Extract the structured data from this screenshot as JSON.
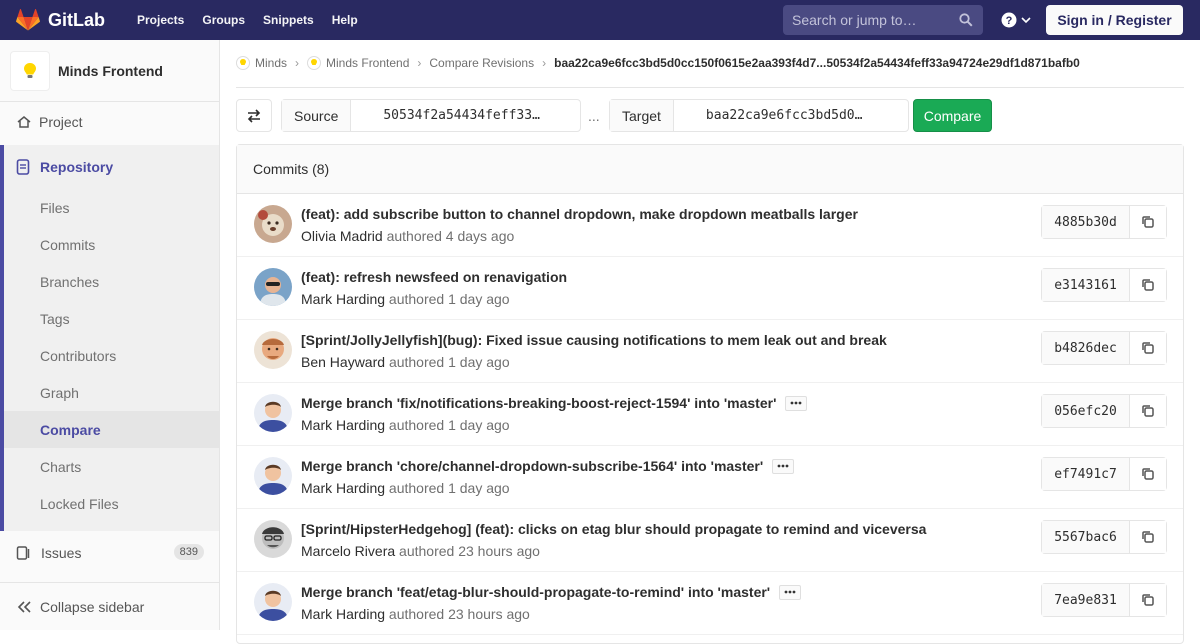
{
  "nav": {
    "brand": "GitLab",
    "links": [
      "Projects",
      "Groups",
      "Snippets",
      "Help"
    ],
    "search_placeholder": "Search or jump to…",
    "sign_in": "Sign in / Register",
    "colors": {
      "bar": "#292961",
      "accent": "#fc6d26"
    }
  },
  "sidebar": {
    "project_name": "Minds Frontend",
    "project_item": "Project",
    "repository": "Repository",
    "repo_items": [
      "Files",
      "Commits",
      "Branches",
      "Tags",
      "Contributors",
      "Graph",
      "Compare",
      "Charts",
      "Locked Files"
    ],
    "active_item": "Compare",
    "issues": "Issues",
    "issues_count": "839",
    "collapse": "Collapse sidebar"
  },
  "breadcrumb": {
    "items": [
      "Minds",
      "Minds Frontend",
      "Compare Revisions"
    ],
    "current": "baa22ca9e6fcc3bd5d0cc150f0615e2aa393f4d7...50534f2a54434feff33a94724e29df1d871bafb0"
  },
  "compare": {
    "source_label": "Source",
    "source_value": "50534f2a54434feff33…",
    "separator": "...",
    "target_label": "Target",
    "target_value": "baa22ca9e6fcc3bd5d0…",
    "button": "Compare"
  },
  "commits": {
    "header": "Commits (8)",
    "authored_word": "authored",
    "rows": [
      {
        "title": "(feat): add subscribe button to channel dropdown, make dropdown meatballs larger",
        "author": "Olivia Madrid",
        "time": "4 days ago",
        "sha": "4885b30d",
        "ellipsis": false,
        "avatar": "olivia"
      },
      {
        "title": "(feat): refresh newsfeed on renavigation",
        "author": "Mark Harding",
        "time": "1 day ago",
        "sha": "e3143161",
        "ellipsis": false,
        "avatar": "mark-sun"
      },
      {
        "title": "[Sprint/JollyJellyfish](bug): Fixed issue causing notifications to mem leak out and break",
        "author": "Ben Hayward",
        "time": "1 day ago",
        "sha": "b4826dec",
        "ellipsis": false,
        "avatar": "ben"
      },
      {
        "title": "Merge branch 'fix/notifications-breaking-boost-reject-1594' into 'master'",
        "author": "Mark Harding",
        "time": "1 day ago",
        "sha": "056efc20",
        "ellipsis": true,
        "avatar": "mark"
      },
      {
        "title": "Merge branch 'chore/channel-dropdown-subscribe-1564' into 'master'",
        "author": "Mark Harding",
        "time": "1 day ago",
        "sha": "ef7491c7",
        "ellipsis": true,
        "avatar": "mark"
      },
      {
        "title": "[Sprint/HipsterHedgehog] (feat): clicks on etag blur should propagate to remind and viceversa",
        "author": "Marcelo Rivera",
        "time": "23 hours ago",
        "sha": "5567bac6",
        "ellipsis": false,
        "avatar": "marcelo"
      },
      {
        "title": "Merge branch 'feat/etag-blur-should-propagate-to-remind' into 'master'",
        "author": "Mark Harding",
        "time": "23 hours ago",
        "sha": "7ea9e831",
        "ellipsis": true,
        "avatar": "mark"
      }
    ]
  }
}
